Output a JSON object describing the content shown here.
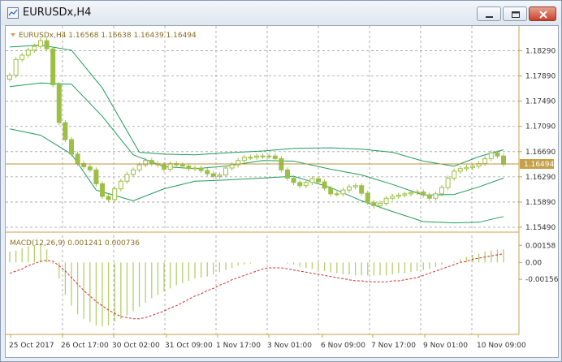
{
  "window": {
    "title": "EURUSDx,H4",
    "buttons": [
      "minimize",
      "restore",
      "close"
    ],
    "icons": [
      "chart-window-icon",
      "minimize-icon",
      "restore-icon",
      "close-icon"
    ]
  },
  "main_panel": {
    "info": "EURUSDx,H4  1.16568 1.16638 1.16439 1.16494",
    "current_price_label": "1.16494",
    "colors": {
      "candle": "#9cbf45",
      "bands": "#1f9b5a",
      "price_line": "#b8963a",
      "grid": "#9e9e9e",
      "axis": "#c8a24a"
    }
  },
  "macd_panel": {
    "label": "MACD(12,26,9) 0.001241 0.000736",
    "colors": {
      "histogram": "#b3cf6a",
      "signal": "#d32b2b"
    }
  },
  "chart_data": [
    {
      "type": "candlestick",
      "title": "EURUSDx,H4",
      "symbol": "EURUSDx",
      "timeframe": "H4",
      "ohlc_header": {
        "open": 1.16568,
        "high": 1.16638,
        "low": 1.16439,
        "close": 1.16494
      },
      "current_price": 1.16494,
      "y_ticks": [
        "1.18290",
        "1.17890",
        "1.17490",
        "1.17090",
        "1.16690",
        "1.16290",
        "1.15890",
        "1.15490"
      ],
      "ylim": [
        1.1549,
        1.184
      ],
      "x_ticks": [
        "25 Oct 2017",
        "26 Oct 17:00",
        "30 Oct 02:00",
        "31 Oct 09:00",
        "1 Nov 17:00",
        "3 Nov 01:00",
        "6 Nov 09:00",
        "7 Nov 17:00",
        "9 Nov 01:00",
        "10 Nov 09:00"
      ],
      "close_series": [
        1.179,
        1.1815,
        1.1822,
        1.183,
        1.1836,
        1.1845,
        1.1832,
        1.1775,
        1.1715,
        1.1688,
        1.1665,
        1.165,
        1.1645,
        1.164,
        1.1618,
        1.1598,
        1.1593,
        1.161,
        1.1622,
        1.1633,
        1.164,
        1.1648,
        1.1655,
        1.165,
        1.1648,
        1.1641,
        1.165,
        1.1648,
        1.1646,
        1.1642,
        1.1643,
        1.1639,
        1.1634,
        1.163,
        1.1632,
        1.1643,
        1.1648,
        1.1655,
        1.166,
        1.166,
        1.1662,
        1.1661,
        1.1662,
        1.1658,
        1.164,
        1.1627,
        1.162,
        1.1615,
        1.162,
        1.1626,
        1.1621,
        1.1611,
        1.1602,
        1.1602,
        1.1608,
        1.1613,
        1.1615,
        1.1603,
        1.1588,
        1.1583,
        1.1587,
        1.1595,
        1.1598,
        1.16,
        1.1602,
        1.1604,
        1.1605,
        1.16,
        1.1595,
        1.1602,
        1.1612,
        1.1627,
        1.1638,
        1.1642,
        1.1644,
        1.1646,
        1.165,
        1.1658,
        1.1667,
        1.1662,
        1.1649
      ],
      "bollinger": {
        "upper": [
          [
            0,
            1.1835
          ],
          [
            5,
            1.1838
          ],
          [
            10,
            1.183
          ],
          [
            15,
            1.177
          ],
          [
            21,
            1.1668
          ],
          [
            25,
            1.1665
          ],
          [
            30,
            1.1664
          ],
          [
            35,
            1.1667
          ],
          [
            41,
            1.167
          ],
          [
            46,
            1.1674
          ],
          [
            52,
            1.1675
          ],
          [
            57,
            1.1673
          ],
          [
            62,
            1.1668
          ],
          [
            67,
            1.1654
          ],
          [
            72,
            1.1646
          ],
          [
            76,
            1.1661
          ],
          [
            80,
            1.1672
          ]
        ],
        "middle": [
          [
            0,
            1.1772
          ],
          [
            5,
            1.1778
          ],
          [
            10,
            1.1776
          ],
          [
            15,
            1.1725
          ],
          [
            20,
            1.1664
          ],
          [
            25,
            1.1645
          ],
          [
            30,
            1.1642
          ],
          [
            35,
            1.1646
          ],
          [
            41,
            1.1655
          ],
          [
            46,
            1.1654
          ],
          [
            52,
            1.1641
          ],
          [
            57,
            1.1632
          ],
          [
            62,
            1.1617
          ],
          [
            67,
            1.16
          ],
          [
            72,
            1.1601
          ],
          [
            76,
            1.1613
          ],
          [
            80,
            1.1627
          ]
        ],
        "lower": [
          [
            0,
            1.1705
          ],
          [
            5,
            1.1695
          ],
          [
            10,
            1.1665
          ],
          [
            14,
            1.1608
          ],
          [
            20,
            1.1591
          ],
          [
            25,
            1.161
          ],
          [
            30,
            1.1622
          ],
          [
            35,
            1.1624
          ],
          [
            41,
            1.1627
          ],
          [
            46,
            1.163
          ],
          [
            52,
            1.1612
          ],
          [
            57,
            1.1591
          ],
          [
            62,
            1.1574
          ],
          [
            67,
            1.1558
          ],
          [
            72,
            1.1556
          ],
          [
            76,
            1.1557
          ],
          [
            80,
            1.1566
          ]
        ]
      }
    },
    {
      "type": "bar",
      "title": "MACD(12,26,9) 0.001241 0.000736",
      "series": [
        {
          "name": "MACD",
          "values": [
            0.001,
            0.0011,
            0.0013,
            0.0015,
            0.0016,
            0.0017,
            0.0012,
            -0.0001,
            -0.0015,
            -0.003,
            -0.004,
            -0.0048,
            -0.0052,
            -0.0055,
            -0.0058,
            -0.0059,
            -0.0058,
            -0.0055,
            -0.0052,
            -0.0049,
            -0.0045,
            -0.0041,
            -0.0037,
            -0.0033,
            -0.003,
            -0.0027,
            -0.0024,
            -0.0021,
            -0.0019,
            -0.0017,
            -0.0015,
            -0.0014,
            -0.0013,
            -0.0011,
            -0.0009,
            -0.0007,
            -0.0005,
            -0.0003,
            -0.0002,
            -0.0001,
            0.0,
            0.0,
            0.0,
            0.0,
            0.0,
            -0.0001,
            -0.0002,
            -0.0004,
            -0.0005,
            -0.0006,
            -0.0007,
            -0.0008,
            -0.0009,
            -0.001,
            -0.0011,
            -0.0011,
            -0.0012,
            -0.0012,
            -0.0012,
            -0.0012,
            -0.0012,
            -0.0012,
            -0.0011,
            -0.001,
            -0.001,
            -0.0009,
            -0.0008,
            -0.0007,
            -0.0006,
            -0.0004,
            -0.0002,
            0.0,
            0.0001,
            0.0003,
            0.0005,
            0.0007,
            0.0008,
            0.001,
            0.0011,
            0.0012,
            0.0012
          ]
        },
        {
          "name": "Signal",
          "values": [
            -0.001,
            -0.0008,
            -0.0006,
            -0.0003,
            -0.0001,
            0.0001,
            0.0002,
            0.0001,
            -0.0003,
            -0.0008,
            -0.0014,
            -0.002,
            -0.0026,
            -0.0031,
            -0.0036,
            -0.004,
            -0.0044,
            -0.0047,
            -0.005,
            -0.0051,
            -0.0052,
            -0.0052,
            -0.0051,
            -0.0049,
            -0.0047,
            -0.0045,
            -0.0042,
            -0.004,
            -0.0037,
            -0.0034,
            -0.0031,
            -0.0029,
            -0.0026,
            -0.0024,
            -0.0021,
            -0.0019,
            -0.0016,
            -0.0014,
            -0.0012,
            -0.001,
            -0.0008,
            -0.0006,
            -0.0005,
            -0.0005,
            -0.0005,
            -0.0006,
            -0.0007,
            -0.0008,
            -0.0009,
            -0.001,
            -0.0011,
            -0.0012,
            -0.0013,
            -0.0014,
            -0.0015,
            -0.0016,
            -0.0017,
            -0.0017,
            -0.0018,
            -0.0018,
            -0.0018,
            -0.0018,
            -0.0017,
            -0.0017,
            -0.0016,
            -0.0015,
            -0.0014,
            -0.0012,
            -0.001,
            -0.0008,
            -0.0006,
            -0.0004,
            -0.0002,
            0.0,
            0.0001,
            0.0003,
            0.0004,
            0.0005,
            0.0006,
            0.0007,
            0.0008
          ]
        }
      ],
      "y_ticks": [
        "0.00158",
        "0.00",
        "-0.001561"
      ],
      "ylim": [
        -0.0065,
        0.0022
      ]
    }
  ]
}
